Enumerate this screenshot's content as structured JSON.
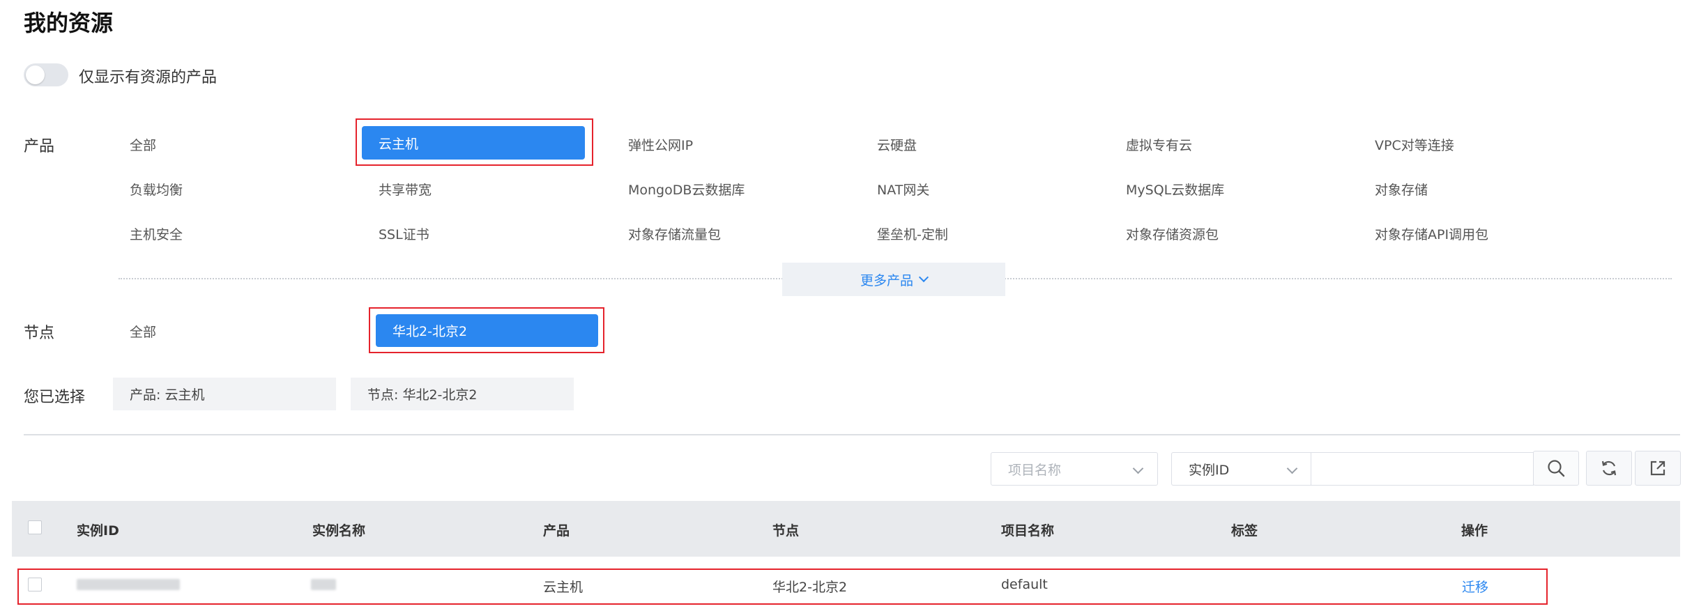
{
  "page": {
    "title": "我的资源"
  },
  "toggle": {
    "label": "仅显示有资源的产品",
    "on": false
  },
  "product_filter": {
    "label": "产品",
    "all_label": "全部",
    "selected": "云主机",
    "options": [
      "弹性公网IP",
      "云硬盘",
      "虚拟专有云",
      "VPC对等连接",
      "负载均衡",
      "共享带宽",
      "MongoDB云数据库",
      "NAT网关",
      "MySQL云数据库",
      "对象存储",
      "主机安全",
      "SSL证书",
      "对象存储流量包",
      "堡垒机-定制",
      "对象存储资源包",
      "对象存储API调用包"
    ],
    "more_label": "更多产品"
  },
  "node_filter": {
    "label": "节点",
    "all_label": "全部",
    "selected": "华北2-北京2"
  },
  "selected_filters": {
    "label": "您已选择",
    "chips": [
      "产品: 云主机",
      "节点: 华北2-北京2"
    ]
  },
  "toolbar": {
    "project_select_placeholder": "项目名称",
    "field_select_value": "实例ID",
    "search_value": "",
    "icons": [
      "search-icon",
      "refresh-icon",
      "export-icon"
    ]
  },
  "table": {
    "headers": [
      "实例ID",
      "实例名称",
      "产品",
      "节点",
      "项目名称",
      "标签",
      "操作"
    ],
    "rows": [
      {
        "product": "云主机",
        "node": "华北2-北京2",
        "project": "default",
        "tag": "",
        "action": "迁移"
      }
    ]
  },
  "colors": {
    "accent": "#2b87f0",
    "highlight_border": "#e5232c",
    "header_bg": "#e8eaed"
  }
}
